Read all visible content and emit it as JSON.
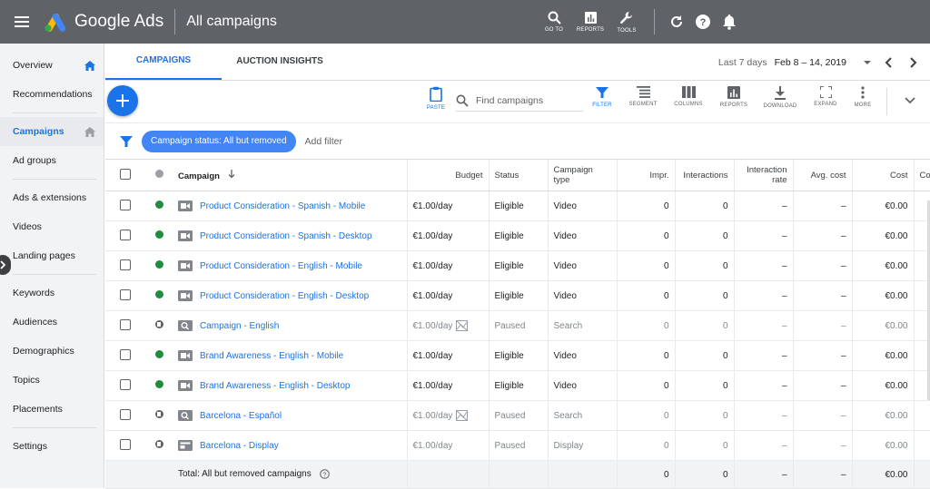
{
  "header": {
    "app_name": "Google Ads",
    "page_title": "All campaigns",
    "tools": [
      {
        "label": "GO TO",
        "icon": "search-icon"
      },
      {
        "label": "REPORTS",
        "icon": "reports-icon"
      },
      {
        "label": "TOOLS",
        "icon": "wrench-icon"
      }
    ]
  },
  "sidebar": {
    "items": [
      {
        "label": "Overview"
      },
      {
        "label": "Recommendations"
      },
      {
        "label": "Campaigns"
      },
      {
        "label": "Ad groups"
      },
      {
        "label": "Ads & extensions"
      },
      {
        "label": "Videos"
      },
      {
        "label": "Landing pages"
      },
      {
        "label": "Keywords"
      },
      {
        "label": "Audiences"
      },
      {
        "label": "Demographics"
      },
      {
        "label": "Topics"
      },
      {
        "label": "Placements"
      },
      {
        "label": "Settings"
      }
    ]
  },
  "tabs": [
    {
      "label": "CAMPAIGNS"
    },
    {
      "label": "AUCTION INSIGHTS"
    }
  ],
  "date": {
    "prefix": "Last 7 days",
    "range": "Feb 8 – 14, 2019"
  },
  "toolbar": {
    "paste_label": "PASTE",
    "search_placeholder": "Find campaigns",
    "filter_label": "FILTER",
    "segment_label": "SEGMENT",
    "columns_label": "COLUMNS",
    "reports_label": "REPORTS",
    "download_label": "DOWNLOAD",
    "expand_label": "EXPAND",
    "more_label": "MORE"
  },
  "filter": {
    "chip": "Campaign status: All but removed",
    "add": "Add filter"
  },
  "table": {
    "columns": {
      "campaign": "Campaign",
      "budget": "Budget",
      "status": "Status",
      "type_1": "Campaign",
      "type_2": "type",
      "impr": "Impr.",
      "interactions": "Interactions",
      "rate_1": "Interaction",
      "rate_2": "rate",
      "avg_cost": "Avg. cost",
      "cost": "Cost",
      "extra": "Co"
    },
    "rows": [
      {
        "name": "Product Consideration - Spanish - Mobile",
        "budget": "€1.00/day",
        "status": "Eligible",
        "type": "Video",
        "impr": "0",
        "interactions": "0",
        "rate": "–",
        "avg_cost": "–",
        "cost": "€0.00"
      },
      {
        "name": "Product Consideration - Spanish - Desktop",
        "budget": "€1.00/day",
        "status": "Eligible",
        "type": "Video",
        "impr": "0",
        "interactions": "0",
        "rate": "–",
        "avg_cost": "–",
        "cost": "€0.00"
      },
      {
        "name": "Product Consideration - English - Mobile",
        "budget": "€1.00/day",
        "status": "Eligible",
        "type": "Video",
        "impr": "0",
        "interactions": "0",
        "rate": "–",
        "avg_cost": "–",
        "cost": "€0.00"
      },
      {
        "name": "Product Consideration - English - Desktop",
        "budget": "€1.00/day",
        "status": "Eligible",
        "type": "Video",
        "impr": "0",
        "interactions": "0",
        "rate": "–",
        "avg_cost": "–",
        "cost": "€0.00"
      },
      {
        "name": "Campaign - English",
        "budget": "€1.00/day",
        "status": "Paused",
        "type": "Search",
        "impr": "0",
        "interactions": "0",
        "rate": "–",
        "avg_cost": "–",
        "cost": "€0.00"
      },
      {
        "name": "Brand Awareness - English - Mobile",
        "budget": "€1.00/day",
        "status": "Eligible",
        "type": "Video",
        "impr": "0",
        "interactions": "0",
        "rate": "–",
        "avg_cost": "–",
        "cost": "€0.00"
      },
      {
        "name": "Brand Awareness - English - Desktop",
        "budget": "€1.00/day",
        "status": "Eligible",
        "type": "Video",
        "impr": "0",
        "interactions": "0",
        "rate": "–",
        "avg_cost": "–",
        "cost": "€0.00"
      },
      {
        "name": "Barcelona - Español",
        "budget": "€1.00/day",
        "status": "Paused",
        "type": "Search",
        "impr": "0",
        "interactions": "0",
        "rate": "–",
        "avg_cost": "–",
        "cost": "€0.00"
      },
      {
        "name": "Barcelona - Display",
        "budget": "€1.00/day",
        "status": "Paused",
        "type": "Display",
        "impr": "0",
        "interactions": "0",
        "rate": "–",
        "avg_cost": "–",
        "cost": "€0.00"
      }
    ],
    "total": {
      "label": "Total: All but removed campaigns",
      "impr": "0",
      "interactions": "0",
      "rate": "–",
      "avg_cost": "–",
      "cost": "€0.00"
    }
  },
  "colors": {
    "topbar": "#5f6368",
    "accent": "#1a73e8",
    "chip": "#4285f4",
    "eligible": "#1e8e3e"
  }
}
